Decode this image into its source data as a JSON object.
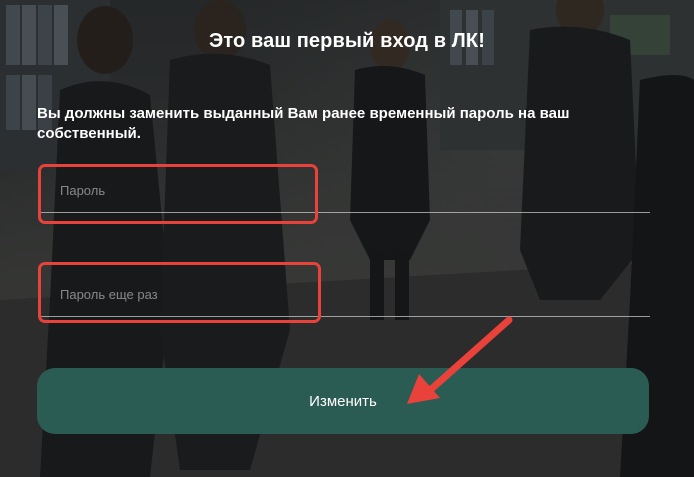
{
  "page": {
    "title": "Это ваш первый вход в ЛК!",
    "notice": "Вы должны заменить выданный Вам ранее временный пароль на ваш собственный."
  },
  "form": {
    "password": {
      "placeholder": "Пароль",
      "value": ""
    },
    "password_repeat": {
      "placeholder": "Пароль еще раз",
      "value": ""
    },
    "submit_label": "Изменить"
  },
  "annotations": {
    "highlight_color": "#e8423a",
    "arrow_color": "#e8423a"
  },
  "colors": {
    "button": "#2b5c53",
    "text": "#ffffff"
  },
  "icons": {
    "arrow": "arrow-pointing-to-button-icon"
  }
}
